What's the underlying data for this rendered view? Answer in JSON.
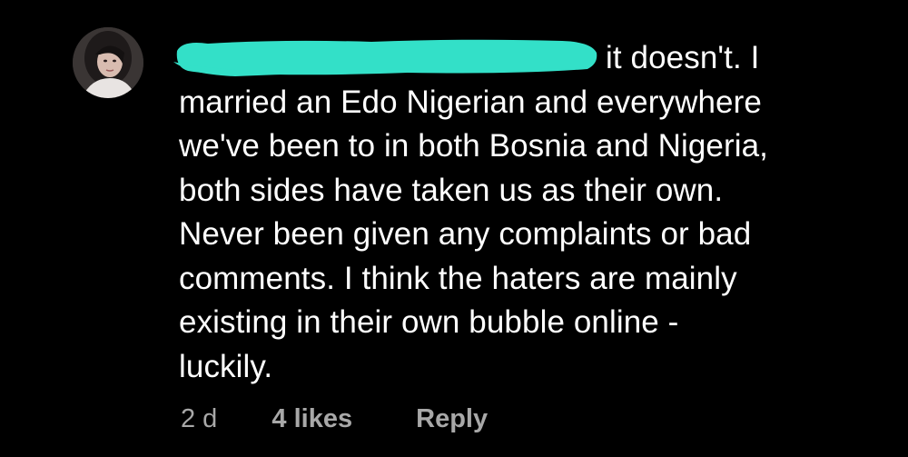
{
  "comment": {
    "first_line_visible": "it doesn't. I",
    "lines": [
      "married an Edo Nigerian and everywhere",
      "we've been to in both Bosnia and Nigeria,",
      "both sides have taken us as their own.",
      "Never been given any complaints or bad",
      "comments. I think the haters are mainly",
      "existing in their own bubble online -",
      "luckily."
    ],
    "redaction_color": "#33E0C8"
  },
  "meta": {
    "time": "2 d",
    "likes": "4 likes",
    "reply": "Reply"
  },
  "theme": {
    "background": "#000000",
    "text": "#FFFFFF",
    "meta_text": "#A8A8A8"
  }
}
